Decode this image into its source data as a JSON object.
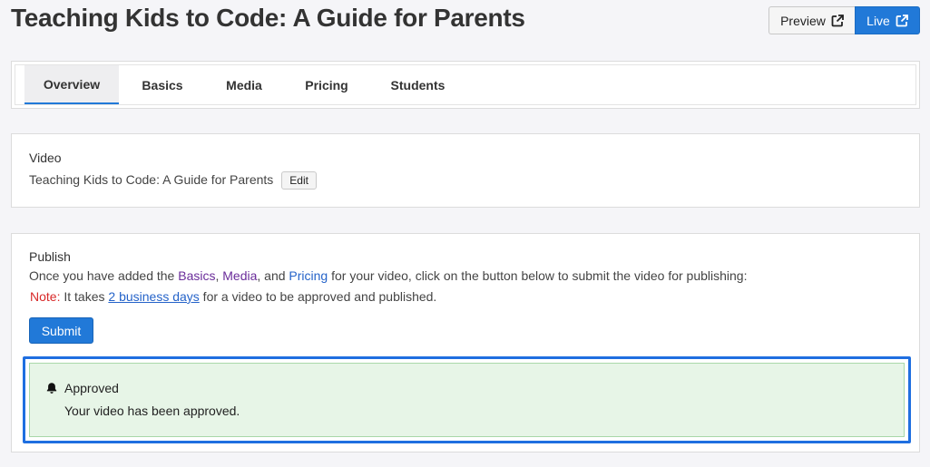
{
  "header": {
    "title": "Teaching Kids to Code: A Guide for Parents",
    "preview_label": "Preview",
    "live_label": "Live"
  },
  "tabs": [
    {
      "label": "Overview",
      "active": true
    },
    {
      "label": "Basics"
    },
    {
      "label": "Media"
    },
    {
      "label": "Pricing"
    },
    {
      "label": "Students"
    }
  ],
  "video": {
    "label": "Video",
    "name": "Teaching Kids to Code: A Guide for Parents",
    "edit_label": "Edit"
  },
  "publish": {
    "label": "Publish",
    "instructions_prefix": "Once you have added the ",
    "basics_link": "Basics",
    "sep1": ", ",
    "media_link": "Media",
    "sep2": ", and ",
    "pricing_link": "Pricing",
    "instructions_suffix": " for your video, click on the button below to submit the video for publishing:",
    "note_label": "Note:",
    "note_prefix": " It takes ",
    "note_link": "2 business days",
    "note_suffix": " for a video to be approved and published.",
    "submit_label": "Submit"
  },
  "alert": {
    "title": "Approved",
    "message": "Your video has been approved."
  },
  "colors": {
    "accent": "#2179d8",
    "note_red": "#d82828",
    "success_bg": "#e7f5e7",
    "highlight": "#1f6fe0"
  }
}
